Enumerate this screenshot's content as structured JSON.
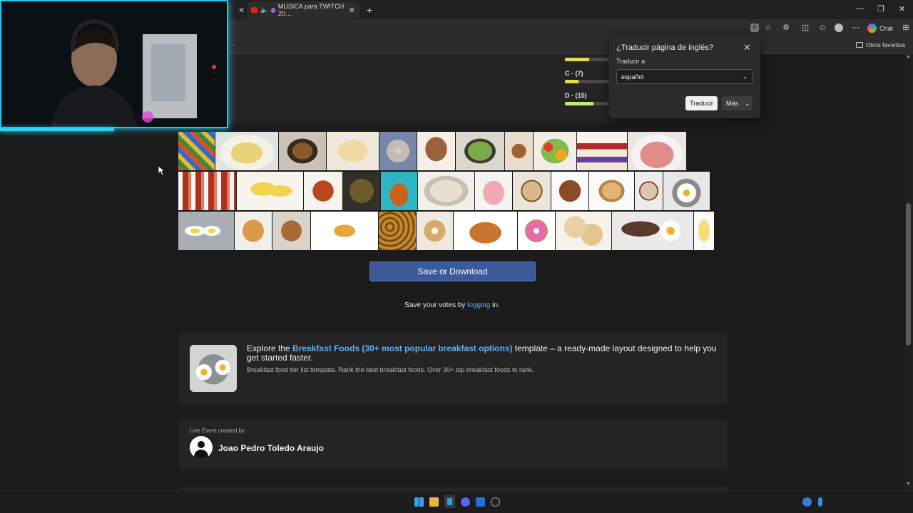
{
  "browser": {
    "tabs": [
      {
        "title": "MUSICA para TWITCH 20…"
      }
    ],
    "new_tab_symbol": "+",
    "chat_label": "Chat",
    "bookmark_folder": "Otros favoritos",
    "overflow_text": "..."
  },
  "tier_stats": [
    {
      "label": "C - (7)",
      "fraction": 0.3
    },
    {
      "label": "D - (15)",
      "fraction": 0.65
    }
  ],
  "translate_popup": {
    "title": "¿Traducir página de inglés?",
    "target_label": "Traducir a",
    "selected_language": "español",
    "translate_button": "Traducir",
    "more_button": "Más"
  },
  "page": {
    "save_button": "Save or Download",
    "votes_prefix": "Save your votes by ",
    "votes_link": "logging",
    "votes_suffix": " in.",
    "template_card": {
      "prefix": "Explore the ",
      "link": "Breakfast Foods (30+ most popular breakfast options)",
      "suffix": " template – a ready-made layout designed to help you get started faster.",
      "description": "Breakfast food tier list template. Rank the best breakfast foods. Over 30+ top breakfast foods to rank."
    },
    "creator": {
      "label": "Live Event created by",
      "name": "Joao Pedro Toledo Araujo"
    }
  },
  "food_rows": [
    [
      "cereal-boxes",
      "omelette",
      "hash-browns-plate",
      "eggs-benedict-plate",
      "bagel",
      "muffin",
      "avocado-toast",
      "cinnamon-rolls",
      "fruit-salad",
      "yogurt-parfait",
      "ham-steak"
    ],
    [
      "bacon",
      "eggs-benedict",
      "baked-beans",
      "hash",
      "fried-chicken",
      "biscuits-gravy",
      "sliced-ham",
      "breakfast-burrito",
      "sausage-patty",
      "toast",
      "oatmeal",
      "fried-eggs"
    ],
    [
      "deviled-eggs",
      "pancakes",
      "french-toast",
      "hash-brown-patty",
      "home-fries",
      "bagels",
      "croissants",
      "donut",
      "biscuits",
      "steak-and-eggs",
      "scrambled-eggs"
    ]
  ],
  "colors": {
    "accent_link": "#5ab1ff",
    "save_button": "#3c5a9a",
    "webcam_glow": "#23c6e8",
    "tier_bar": "#c8d94a"
  }
}
